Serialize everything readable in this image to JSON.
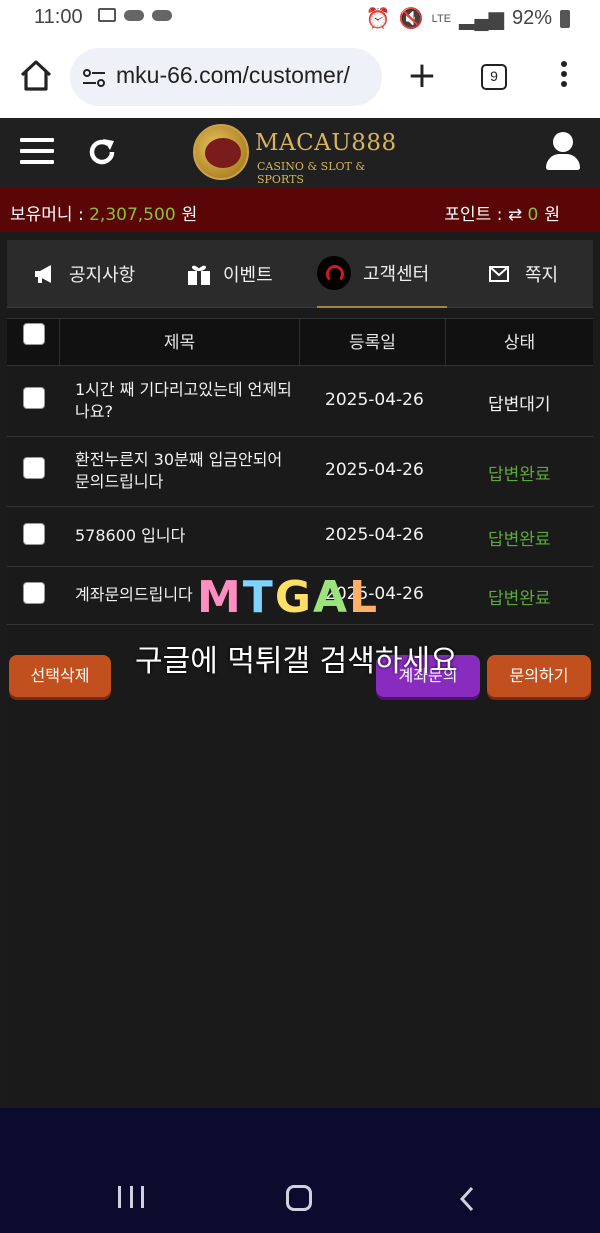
{
  "status_bar": {
    "time": "11:00",
    "network": "LTE",
    "battery": "92%"
  },
  "browser": {
    "url": "mku-66.com/customer/",
    "tab_count": "9"
  },
  "site": {
    "brand": "MACAU888",
    "tagline": "CASINO & SLOT & SPORTS"
  },
  "account": {
    "money_label": "보유머니 : ",
    "money_value": "2,307,500",
    "money_unit": "원",
    "point_label": "포인트 : ",
    "point_value": "0",
    "point_unit": "원"
  },
  "tabs": [
    {
      "label": "공지사항",
      "icon": "megaphone-icon"
    },
    {
      "label": "이벤트",
      "icon": "gift-icon"
    },
    {
      "label": "고객센터",
      "icon": "headset-icon",
      "active": true
    },
    {
      "label": "쪽지",
      "icon": "envelope-icon"
    }
  ],
  "table": {
    "headers": {
      "subject": "제목",
      "date": "등록일",
      "status": "상태"
    },
    "rows": [
      {
        "subject": "1시간 째 기다리고있는데 언제되나요?",
        "date": "2025-04-26",
        "status": "답변대기"
      },
      {
        "subject": "환전누른지 30분째 입금안되어 문의드립니다",
        "date": "2025-04-26",
        "status": "답변완료"
      },
      {
        "subject": "578600 입니다",
        "date": "2025-04-26",
        "status": "답변완료"
      },
      {
        "subject": "계좌문의드립니다",
        "date": "2025-04-26",
        "status": "답변완료"
      }
    ]
  },
  "actions": {
    "delete_selected": "선택삭제",
    "account_inquiry": "계좌문의",
    "inquire": "문의하기"
  },
  "watermark": {
    "logo": "MTGAL",
    "text": "구글에 먹튀갤 검색하세요"
  },
  "colors": {
    "money_bar": "#5a0606",
    "green_value": "#88c23a",
    "status_done": "#5da83a",
    "button_orange": "#c2501f",
    "button_purple": "#8a2bc0"
  }
}
